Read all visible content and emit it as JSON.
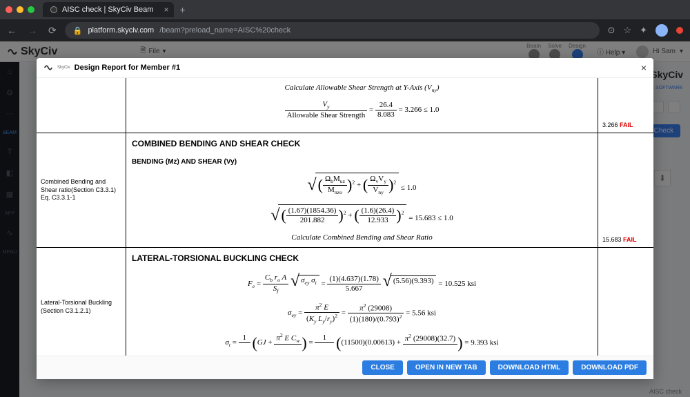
{
  "browser": {
    "tab_title": "AISC check | SkyCiv Beam",
    "url_host": "platform.skyciv.com",
    "url_path": "/beam?preload_name=AISC%20check"
  },
  "app": {
    "logo": "SkyCiv",
    "file_menu": "File",
    "help": "Help",
    "user_name": "Hi Sam",
    "top_icons": [
      "Beam",
      "Solve",
      "Design"
    ],
    "right_brand": "SkyCiv",
    "right_brand_sub": "E SOFTWARE",
    "btn_check": "Check",
    "footer_status": "AISC check",
    "rail": [
      "⌂",
      "⚙",
      "···",
      "BEAM",
      "T",
      "◧",
      "▦",
      "APP",
      "∿",
      "MENU"
    ]
  },
  "modal": {
    "title": "Design Report for Member #1",
    "logo_sub": "SkyCiv",
    "close": "×",
    "footer": {
      "close": "CLOSE",
      "open_tab": "OPEN IN NEW TAB",
      "download_html": "DOWNLOAD HTML",
      "download_pdf": "DOWNLOAD PDF"
    }
  },
  "report": {
    "row1": {
      "caption": "Calculate Allowable Shear Strength at Y-Axis (V_{ny})",
      "eq_lhs_top": "V_y",
      "eq_lhs_bot": "Allowable Shear Strength",
      "eq_rhs_top": "26.4",
      "eq_rhs_bot": "8.083",
      "eq_val": "= 3.266 ≤ 1.0",
      "result_val": "3.266",
      "result_status": "FAIL"
    },
    "row2": {
      "label_line1": "Combined Bending and Shear ratio(Section C3.3.1)",
      "label_line2": "Eq. C3.3.1-1",
      "title": "COMBINED BENDING AND SHEAR CHECK",
      "subtitle": "BENDING (Mz) AND SHEAR (Vy)",
      "eq1_t1_top": "Ω_b M_uz",
      "eq1_t1_bot": "M_{nzo}",
      "eq1_t2_top": "Ω_v V_y",
      "eq1_t2_bot": "V_{ny}",
      "eq1_tail": "≤ 1.0",
      "eq2_t1_top": "(1.67)(1854.36)",
      "eq2_t1_bot": "201.882",
      "eq2_t2_top": "(1.6)(26.4)",
      "eq2_t2_bot": "12.933",
      "eq2_tail": "= 15.683 ≤ 1.0",
      "caption": "Calculate Combined Bending and Shear Ratio",
      "result_val": "15.683",
      "result_status": "FAIL"
    },
    "row3": {
      "label": "Lateral-Torsional Buckling (Section C3.1.2.1)",
      "title": "LATERAL-TORSIONAL BUCKLING CHECK",
      "eq1": "F_{e} = \\frac{C_{b} r_{o} A}{S_{f}} \\sqrt{σ_{ey} σ_{t}} = \\frac{(1)(4.637)(1.78)}{5.667} \\sqrt{(5.56)(9.393)} = 10.525\\ ksi",
      "eq1_lhs": "F_e =",
      "eq1_f1_top": "C_b r_o A",
      "eq1_f1_bot": "S_f",
      "eq1_sqrt1": "σ_{ey} σ_t",
      "eq1_f2_top": "(1)(4.637)(1.78)",
      "eq1_f2_bot": "5.667",
      "eq1_sqrt2": "(5.56)(9.393)",
      "eq1_tail": "= 10.525 ksi",
      "eq2_lhs": "σ_{ey} =",
      "eq2_f1_top": "π² E",
      "eq2_f1_bot": "(K_y L_y / r_y)²",
      "eq2_f2_top": "π² (29008)",
      "eq2_f2_bot": "(1)(180)/(0.793)²",
      "eq2_tail": "= 5.56 ksi",
      "eq3_lhs": "σ_t =",
      "eq3_f1_top": "1",
      "eq3_f1_bot": " ",
      "eq3_mid1": "GJ +",
      "eq3_f2_top": "π² E C_w",
      "eq3_f2_bot": " ",
      "eq3_f3_top": "1",
      "eq3_f3_bot": " ",
      "eq3_mid2": "(11500)(0.00613) +",
      "eq3_f4_top": "π² (29008)(32.7)",
      "eq3_f4_bot": " ",
      "eq3_tail": "= 9.393 ksi"
    }
  }
}
